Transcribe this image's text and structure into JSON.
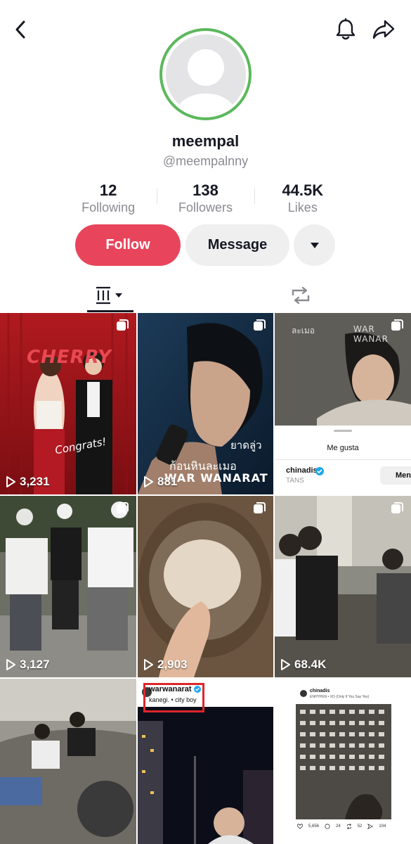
{
  "header": {
    "back_icon": "chevron-left-icon",
    "bell_icon": "bell-icon",
    "share_icon": "share-arrow-icon"
  },
  "profile": {
    "display_name": "meempal",
    "handle": "@meempalnny",
    "ring_color": "#5cb85c"
  },
  "stats": [
    {
      "value": "12",
      "label": "Following"
    },
    {
      "value": "138",
      "label": "Followers"
    },
    {
      "value": "44.5K",
      "label": "Likes"
    }
  ],
  "actions": {
    "follow_label": "Follow",
    "message_label": "Message",
    "follow_color": "#e8455c"
  },
  "tabs": {
    "videos_icon": "grid-columns-icon",
    "reposts_icon": "repost-icon"
  },
  "videos": [
    {
      "views": "3,231",
      "overlay_top": "CHERRY",
      "overlay_sticker": "Congrats!",
      "multi": true
    },
    {
      "views": "881",
      "overlay_text_1": "ยาดลู่ว",
      "overlay_text_2": "ก้อนหินละเมอ",
      "overlay_text_3": "WAR WANARAT",
      "multi": true
    },
    {
      "views": "",
      "overlay_top": "ละเมอ",
      "overlay_brand": "WAR WANAR",
      "sheet_title": "Me gusta",
      "sheet_user": "chinadis",
      "sheet_button": "Men",
      "sheet_sub": "TANS",
      "multi": true
    },
    {
      "views": "3,127",
      "multi": true
    },
    {
      "views": "2,903",
      "multi": true
    },
    {
      "views": "68.4K",
      "multi": true
    },
    {
      "views": "",
      "multi": false
    },
    {
      "views": "",
      "post_user": "warwanarat",
      "post_music": "kanegi. • city boy",
      "multi": false
    },
    {
      "views": "",
      "post_user": "chinadis",
      "post_sub": "ENHYPEN • XO (Only If You Say Yes)",
      "post_stats": [
        "5,656",
        "24",
        "52",
        "104"
      ],
      "multi": false
    }
  ]
}
